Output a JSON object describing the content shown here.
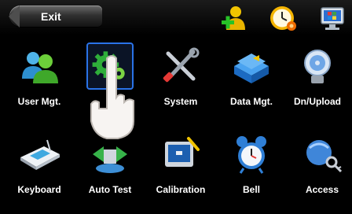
{
  "header": {
    "exit_label": "Exit",
    "icons": [
      "add-user-icon",
      "clock-icon",
      "windows-pc-icon"
    ]
  },
  "menu": {
    "items": [
      {
        "label": "User Mgt.",
        "icon": "users-icon",
        "selected": false
      },
      {
        "label": "",
        "icon": "gear-icon",
        "selected": true
      },
      {
        "label": "System",
        "icon": "tools-icon",
        "selected": false
      },
      {
        "label": "Data Mgt.",
        "icon": "database-icon",
        "selected": false
      },
      {
        "label": "Dn/Upload",
        "icon": "usb-disc-icon",
        "selected": false
      },
      {
        "label": "Keyboard",
        "icon": "keyboard-icon",
        "selected": false
      },
      {
        "label": "Auto Test",
        "icon": "auto-test-icon",
        "selected": false
      },
      {
        "label": "Calibration",
        "icon": "calibration-icon",
        "selected": false
      },
      {
        "label": "Bell",
        "icon": "alarm-bell-icon",
        "selected": false
      },
      {
        "label": "Access",
        "icon": "access-keys-icon",
        "selected": false
      }
    ]
  },
  "colors": {
    "selection_border": "#2a73e8",
    "background": "#000000",
    "text": "#ffffff"
  }
}
